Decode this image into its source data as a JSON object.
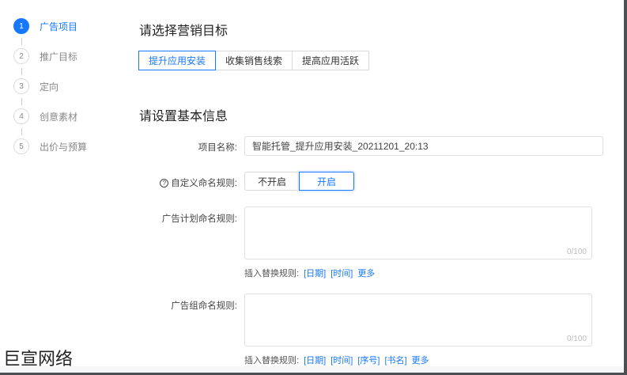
{
  "steps": [
    {
      "num": "1",
      "label": "广告项目"
    },
    {
      "num": "2",
      "label": "推广目标"
    },
    {
      "num": "3",
      "label": "定向"
    },
    {
      "num": "4",
      "label": "创意素材"
    },
    {
      "num": "5",
      "label": "出价与预算"
    }
  ],
  "goal_section": {
    "title": "请选择营销目标",
    "options": [
      "提升应用安装",
      "收集销售线索",
      "提高应用活跃"
    ],
    "selected": "提升应用安装"
  },
  "basic_section": {
    "title": "请设置基本信息",
    "project_name_label": "项目名称:",
    "project_name_value": "智能托管_提升应用安装_20211201_20:13",
    "custom_naming_label": "自定义命名规则:",
    "custom_naming_off": "不开启",
    "custom_naming_on": "开启",
    "plan_naming_label": "广告计划命名规则:",
    "plan_counter": "0/100",
    "plan_insert_label": "插入替换规则:",
    "plan_insert_links": [
      "[日期]",
      "[时间]",
      "更多"
    ],
    "group_naming_label": "广告组命名规则:",
    "group_counter": "0/100",
    "group_insert_label": "插入替换规则:",
    "group_insert_links": [
      "[日期]",
      "[时间]",
      "[序号]",
      "[书名]",
      "更多"
    ]
  },
  "watermark": "巨宣网络",
  "colors": {
    "accent": "#1677ff"
  }
}
